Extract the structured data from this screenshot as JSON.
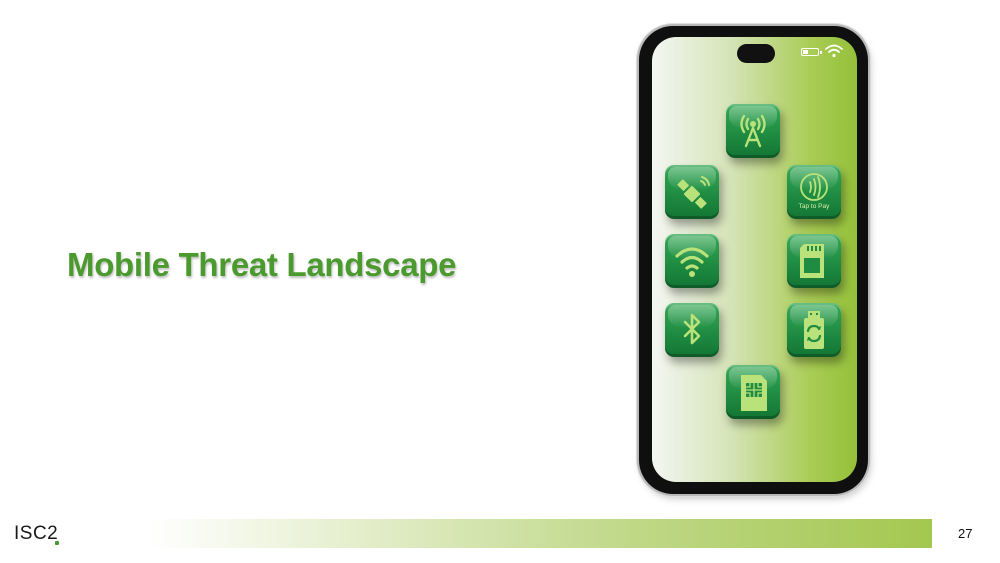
{
  "slide": {
    "title": "Mobile Threat Landscape",
    "page_number": "27",
    "logo_text": "ISC2"
  },
  "phone": {
    "apps": [
      {
        "icon": "cell-tower-icon"
      },
      {
        "icon": "satellite-icon"
      },
      {
        "icon": "tap-to-pay-icon",
        "label": "Tap to Pay"
      },
      {
        "icon": "wifi-icon"
      },
      {
        "icon": "sd-card-icon"
      },
      {
        "icon": "bluetooth-icon"
      },
      {
        "icon": "usb-sync-icon"
      },
      {
        "icon": "sim-card-icon"
      }
    ],
    "status_icons": [
      "battery-icon",
      "wifi-icon"
    ]
  },
  "colors": {
    "accent": "#4a9a2e",
    "app_green": "#1f8c42",
    "footer_green": "#a4c74f"
  }
}
